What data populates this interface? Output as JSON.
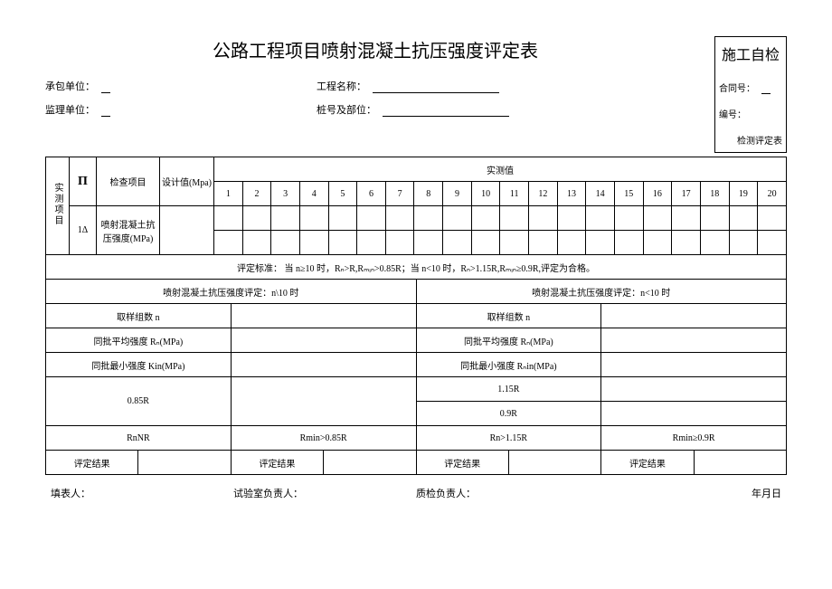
{
  "title": "公路工程项目喷射混凝土抗压强度评定表",
  "sidebox": {
    "heading": "施工自检",
    "contract_no_label": "合同号：",
    "doc_no_label": "编号：",
    "bottom": "检测评定表"
  },
  "meta": {
    "contractor_label": "承包单位：",
    "supervisor_label": "监理单位：",
    "project_label": "工程名称：",
    "station_label": "桩号及部位："
  },
  "symbol": "П",
  "table_head": {
    "measured_item": "实测项目",
    "one_delta": "1Δ",
    "check_item": "检查项目",
    "design_value": "设计值(Mpa)",
    "measured_value": "实测值",
    "cols": [
      "1",
      "2",
      "3",
      "4",
      "5",
      "6",
      "7",
      "8",
      "9",
      "10",
      "11",
      "12",
      "13",
      "14",
      "15",
      "16",
      "17",
      "18",
      "19",
      "20"
    ],
    "item_name": "喷射混凝土抗压强度(MPa)"
  },
  "criteria": "评定标准：  当 n≥10 时，Rₙ>R,Rₘᵢₙ>0.85R；当 n<10 时，Rₙ>1.15R,Rₘᵢₙ≥0.9R,评定为合格。",
  "sections": {
    "left_title": "喷射混凝土抗压强度评定：n\\10 时",
    "right_title": "喷射混凝土抗压强度评定：n<10 时",
    "group_n": "取样组数 n",
    "avg_l": "同批平均强度 Rₙ(MPa)",
    "avg_r": "同批平均强度 Rₙ(MPa)",
    "min_l": "同批最小强度 Kin(MPa)",
    "min_r": "同批最小强度 Rₙin(MPa)",
    "f085": "0.85R",
    "f115": "1.15R",
    "f09": "0.9R",
    "rnnr": "RnNR",
    "rmin085": "Rmin>0.85R",
    "rn115": "Rn>1.15R",
    "rmin09": "Rmin≥0.9R",
    "result": "评定结果"
  },
  "footer": {
    "filler": "填表人：",
    "lab": "试验室负责人：",
    "qc": "质检负责人：",
    "date": "年月日"
  }
}
